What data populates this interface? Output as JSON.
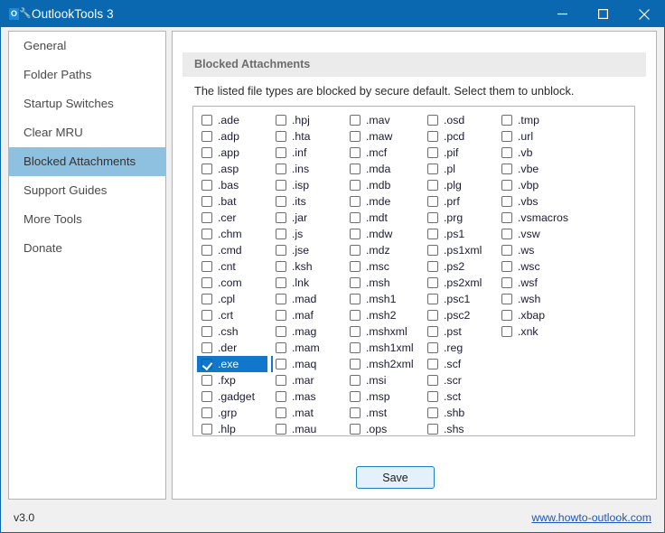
{
  "window": {
    "title": "OutlookTools 3",
    "icon": "wrench-icon",
    "icon_letter": "O",
    "titlebar_color": "#0a68b0",
    "controls": [
      {
        "name": "minimize-button",
        "label": "Minimize"
      },
      {
        "name": "maximize-button",
        "label": "Maximize"
      },
      {
        "name": "close-button",
        "label": "Close"
      }
    ]
  },
  "sidebar": {
    "items": [
      {
        "label": "General",
        "active": false
      },
      {
        "label": "Folder Paths",
        "active": false
      },
      {
        "label": "Startup Switches",
        "active": false
      },
      {
        "label": "Clear MRU",
        "active": false
      },
      {
        "label": "Blocked Attachments",
        "active": true
      },
      {
        "label": "Support Guides",
        "active": false
      },
      {
        "label": "More Tools",
        "active": false
      },
      {
        "label": "Donate",
        "active": false
      }
    ],
    "active_color": "#8ec1e0"
  },
  "main": {
    "group_title": "Blocked Attachments",
    "description": "The listed file types are blocked by secure default. Select them to unblock.",
    "save_label": "Save",
    "selection_color": "#1177cc",
    "columns": [
      {
        "items": [
          {
            "label": ".ade",
            "checked": false,
            "selected": false
          },
          {
            "label": ".adp",
            "checked": false,
            "selected": false
          },
          {
            "label": ".app",
            "checked": false,
            "selected": false
          },
          {
            "label": ".asp",
            "checked": false,
            "selected": false
          },
          {
            "label": ".bas",
            "checked": false,
            "selected": false
          },
          {
            "label": ".bat",
            "checked": false,
            "selected": false
          },
          {
            "label": ".cer",
            "checked": false,
            "selected": false
          },
          {
            "label": ".chm",
            "checked": false,
            "selected": false
          },
          {
            "label": ".cmd",
            "checked": false,
            "selected": false
          },
          {
            "label": ".cnt",
            "checked": false,
            "selected": false
          },
          {
            "label": ".com",
            "checked": false,
            "selected": false
          },
          {
            "label": ".cpl",
            "checked": false,
            "selected": false
          },
          {
            "label": ".crt",
            "checked": false,
            "selected": false
          },
          {
            "label": ".csh",
            "checked": false,
            "selected": false
          },
          {
            "label": ".der",
            "checked": false,
            "selected": false
          },
          {
            "label": ".exe",
            "checked": true,
            "selected": true
          },
          {
            "label": ".fxp",
            "checked": false,
            "selected": false
          },
          {
            "label": ".gadget",
            "checked": false,
            "selected": false
          },
          {
            "label": ".grp",
            "checked": false,
            "selected": false
          },
          {
            "label": ".hlp",
            "checked": false,
            "selected": false
          }
        ]
      },
      {
        "items": [
          {
            "label": ".hpj",
            "checked": false,
            "selected": false
          },
          {
            "label": ".hta",
            "checked": false,
            "selected": false
          },
          {
            "label": ".inf",
            "checked": false,
            "selected": false
          },
          {
            "label": ".ins",
            "checked": false,
            "selected": false
          },
          {
            "label": ".isp",
            "checked": false,
            "selected": false
          },
          {
            "label": ".its",
            "checked": false,
            "selected": false
          },
          {
            "label": ".jar",
            "checked": false,
            "selected": false
          },
          {
            "label": ".js",
            "checked": false,
            "selected": false
          },
          {
            "label": ".jse",
            "checked": false,
            "selected": false
          },
          {
            "label": ".ksh",
            "checked": false,
            "selected": false
          },
          {
            "label": ".lnk",
            "checked": false,
            "selected": false
          },
          {
            "label": ".mad",
            "checked": false,
            "selected": false
          },
          {
            "label": ".maf",
            "checked": false,
            "selected": false
          },
          {
            "label": ".mag",
            "checked": false,
            "selected": false
          },
          {
            "label": ".mam",
            "checked": false,
            "selected": false
          },
          {
            "label": ".maq",
            "checked": false,
            "selected": false,
            "focus": true
          },
          {
            "label": ".mar",
            "checked": false,
            "selected": false
          },
          {
            "label": ".mas",
            "checked": false,
            "selected": false
          },
          {
            "label": ".mat",
            "checked": false,
            "selected": false
          },
          {
            "label": ".mau",
            "checked": false,
            "selected": false
          }
        ]
      },
      {
        "items": [
          {
            "label": ".mav",
            "checked": false,
            "selected": false
          },
          {
            "label": ".maw",
            "checked": false,
            "selected": false
          },
          {
            "label": ".mcf",
            "checked": false,
            "selected": false
          },
          {
            "label": ".mda",
            "checked": false,
            "selected": false
          },
          {
            "label": ".mdb",
            "checked": false,
            "selected": false
          },
          {
            "label": ".mde",
            "checked": false,
            "selected": false
          },
          {
            "label": ".mdt",
            "checked": false,
            "selected": false
          },
          {
            "label": ".mdw",
            "checked": false,
            "selected": false
          },
          {
            "label": ".mdz",
            "checked": false,
            "selected": false
          },
          {
            "label": ".msc",
            "checked": false,
            "selected": false
          },
          {
            "label": ".msh",
            "checked": false,
            "selected": false
          },
          {
            "label": ".msh1",
            "checked": false,
            "selected": false
          },
          {
            "label": ".msh2",
            "checked": false,
            "selected": false
          },
          {
            "label": ".mshxml",
            "checked": false,
            "selected": false
          },
          {
            "label": ".msh1xml",
            "checked": false,
            "selected": false
          },
          {
            "label": ".msh2xml",
            "checked": false,
            "selected": false
          },
          {
            "label": ".msi",
            "checked": false,
            "selected": false
          },
          {
            "label": ".msp",
            "checked": false,
            "selected": false
          },
          {
            "label": ".mst",
            "checked": false,
            "selected": false
          },
          {
            "label": ".ops",
            "checked": false,
            "selected": false
          }
        ]
      },
      {
        "items": [
          {
            "label": ".osd",
            "checked": false,
            "selected": false
          },
          {
            "label": ".pcd",
            "checked": false,
            "selected": false
          },
          {
            "label": ".pif",
            "checked": false,
            "selected": false
          },
          {
            "label": ".pl",
            "checked": false,
            "selected": false
          },
          {
            "label": ".plg",
            "checked": false,
            "selected": false
          },
          {
            "label": ".prf",
            "checked": false,
            "selected": false
          },
          {
            "label": ".prg",
            "checked": false,
            "selected": false
          },
          {
            "label": ".ps1",
            "checked": false,
            "selected": false
          },
          {
            "label": ".ps1xml",
            "checked": false,
            "selected": false
          },
          {
            "label": ".ps2",
            "checked": false,
            "selected": false
          },
          {
            "label": ".ps2xml",
            "checked": false,
            "selected": false
          },
          {
            "label": ".psc1",
            "checked": false,
            "selected": false
          },
          {
            "label": ".psc2",
            "checked": false,
            "selected": false
          },
          {
            "label": ".pst",
            "checked": false,
            "selected": false
          },
          {
            "label": ".reg",
            "checked": false,
            "selected": false
          },
          {
            "label": ".scf",
            "checked": false,
            "selected": false
          },
          {
            "label": ".scr",
            "checked": false,
            "selected": false
          },
          {
            "label": ".sct",
            "checked": false,
            "selected": false
          },
          {
            "label": ".shb",
            "checked": false,
            "selected": false
          },
          {
            "label": ".shs",
            "checked": false,
            "selected": false
          }
        ]
      },
      {
        "items": [
          {
            "label": ".tmp",
            "checked": false,
            "selected": false
          },
          {
            "label": ".url",
            "checked": false,
            "selected": false
          },
          {
            "label": ".vb",
            "checked": false,
            "selected": false
          },
          {
            "label": ".vbe",
            "checked": false,
            "selected": false
          },
          {
            "label": ".vbp",
            "checked": false,
            "selected": false
          },
          {
            "label": ".vbs",
            "checked": false,
            "selected": false
          },
          {
            "label": ".vsmacros",
            "checked": false,
            "selected": false
          },
          {
            "label": ".vsw",
            "checked": false,
            "selected": false
          },
          {
            "label": ".ws",
            "checked": false,
            "selected": false
          },
          {
            "label": ".wsc",
            "checked": false,
            "selected": false
          },
          {
            "label": ".wsf",
            "checked": false,
            "selected": false
          },
          {
            "label": ".wsh",
            "checked": false,
            "selected": false
          },
          {
            "label": ".xbap",
            "checked": false,
            "selected": false
          },
          {
            "label": ".xnk",
            "checked": false,
            "selected": false
          }
        ]
      }
    ]
  },
  "footer": {
    "version": "v3.0",
    "link": "www.howto-outlook.com",
    "link_color": "#1a58c0"
  }
}
